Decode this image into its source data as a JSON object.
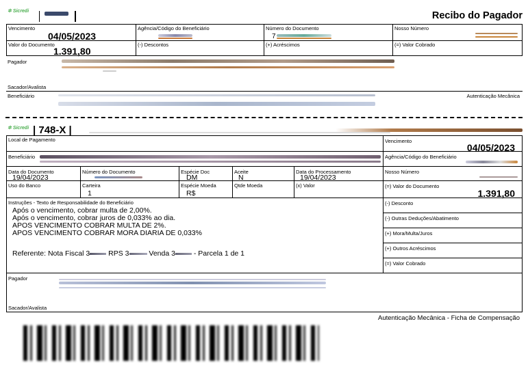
{
  "receipt": {
    "bank_brand": "Sicredi",
    "title": "Recibo do Pagador",
    "vencimento_label": "Vencimento",
    "vencimento": "04/05/2023",
    "agencia_label": "Agência/Código do Beneficiário",
    "numero_documento_label": "Número do Documento",
    "numero_documento_prefix": "7",
    "nosso_numero_label": "Nosso Número",
    "valor_documento_label": "Valor do Documento",
    "valor_documento": "1.391,80",
    "descontos_label": "(-) Descontos",
    "acrescimos_label": "(+) Acréscimos",
    "valor_cobrado_label": "(=) Valor Cobrado",
    "pagador_label": "Pagador",
    "sacador_label": "Sacador/Avalista",
    "beneficiario_label": "Beneficiário",
    "autenticacao_label": "Autenticação Mecânica"
  },
  "slip": {
    "bank_brand": "Sicredi",
    "bank_code": "| 748-X |",
    "local_pagamento_label": "Local de Pagamento",
    "vencimento_label": "Vencimento",
    "vencimento": "04/05/2023",
    "beneficiario_label": "Beneficiário",
    "agencia_label": "Agência/Código do Beneficiário",
    "data_documento_label": "Data do Documento",
    "data_documento": "19/04/2023",
    "numero_documento_label": "Número do Documento",
    "especie_doc_label": "Espécie Doc",
    "especie_doc": "DM",
    "aceite_label": "Aceite",
    "aceite": "N",
    "data_processamento_label": "Data do Processamento",
    "data_processamento": "19/04/2023",
    "nosso_numero_label": "Nosso Número",
    "uso_banco_label": "Uso do Banco",
    "carteira_label": "Carteira",
    "carteira": "1",
    "especie_moeda_label": "Espécie Moeda",
    "especie_moeda": "R$",
    "qtde_moeda_label": "Qtde Moeda",
    "x_valor_label": "(x) Valor",
    "valor_documento_label": "(=) Valor do Documento",
    "valor_documento": "1.391,80",
    "instrucoes_label": "Instruções - Texto de Responsabilidade do Beneficiário",
    "instrucoes": [
      "Após o vencimento, cobrar multa de 2,00%.",
      "Após o vencimento, cobrar juros de 0,033% ao dia.",
      "APOS VENCIMENTO COBRAR MULTA DE 2%.",
      "APOS VENCIMENTO COBRAR MORA DIARIA DE 0,033%"
    ],
    "referente_1": "Referente: Nota Fiscal 3",
    "referente_2": "RPS 3",
    "referente_3": "Venda 3",
    "referente_4": "- Parcela 1 de 1",
    "desconto_label": "(-) Desconto",
    "outras_deducoes_label": "(-) Outras Deduções/Abatimento",
    "mora_label": "(+) Mora/Multa/Juros",
    "outros_acrescimos_label": "(+) Outros Acréscimos",
    "valor_cobrado_label": "(=) Valor Cobrado",
    "pagador_label": "Pagador",
    "sacador_label": "Sacador/Avalista",
    "autenticacao_label": "Autenticação Mecânica - Ficha de Compensação"
  }
}
